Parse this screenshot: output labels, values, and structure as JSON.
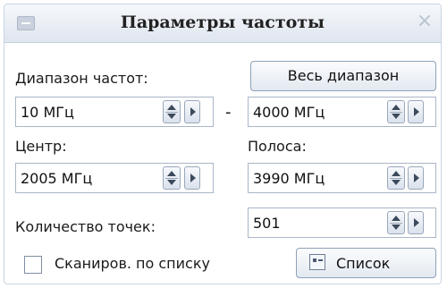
{
  "window": {
    "title": "Параметры частоты",
    "sysmenu_icon": "window-menu-icon",
    "close_icon": "close-icon"
  },
  "range": {
    "label": "Диапазон частот:",
    "start_value": "10 МГц",
    "separator": "-",
    "end_value": "4000 МГц",
    "full_range_button": "Весь диапазон"
  },
  "center": {
    "label": "Центр:",
    "value": "2005 МГц"
  },
  "band": {
    "label": "Полоса:",
    "value": "3990 МГц"
  },
  "points": {
    "label": "Количество точек:",
    "value": "501"
  },
  "scan": {
    "checkbox_label": "Сканиров. по списку",
    "checked": false
  },
  "list_button": {
    "label": "Список",
    "icon": "list-icon"
  },
  "colors": {
    "titlebar": "#dfe6ef",
    "border": "#a9b6c6",
    "button_border": "#8ea1b8"
  }
}
